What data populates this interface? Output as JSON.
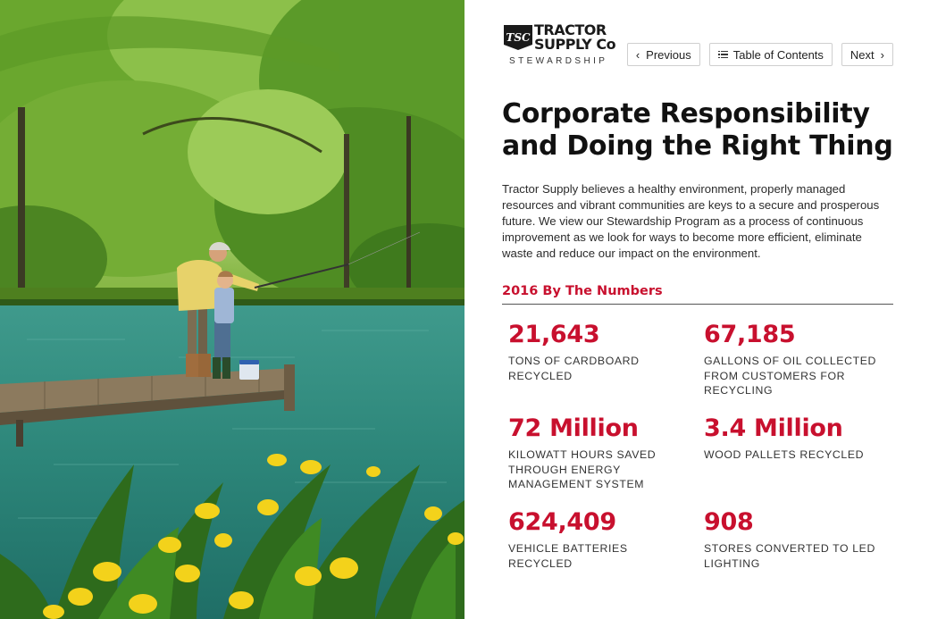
{
  "brand": {
    "badge_text": "TSC",
    "name_line1": "TRACTOR",
    "name_line2": "SUPPLY Co",
    "subtitle": "STEWARDSHIP"
  },
  "nav": {
    "previous_label": "Previous",
    "toc_label": "Table of Contents",
    "next_label": "Next"
  },
  "page": {
    "title": "Corporate Responsibility and Doing the Right Thing",
    "intro": "Tractor Supply believes a healthy environment, properly managed resources and vibrant communities are keys to a secure and prosperous future. We view our Stewardship Program as a process of continuous improvement as we look for ways to become more efficient, eliminate waste and reduce our impact on the environment.",
    "section_heading": "2016 By The Numbers"
  },
  "stats": [
    {
      "value": "21,643",
      "label": "Tons of cardboard recycled"
    },
    {
      "value": "67,185",
      "label": "Gallons of oil collected from customers for recycling"
    },
    {
      "value": "72 Million",
      "label": "Kilowatt hours saved through energy management system"
    },
    {
      "value": "3.4 Million",
      "label": "Wood pallets recycled"
    },
    {
      "value": "624,409",
      "label": "Vehicle batteries recycled"
    },
    {
      "value": "908",
      "label": "Stores converted to LED lighting"
    }
  ],
  "colors": {
    "accent_red": "#c8102e",
    "water": "#2f8f86",
    "foliage": "#5e9a2a",
    "flowers": "#f3d21b"
  },
  "icons": {
    "previous": "chevron-left-icon",
    "toc": "list-icon",
    "next": "chevron-right-icon"
  }
}
